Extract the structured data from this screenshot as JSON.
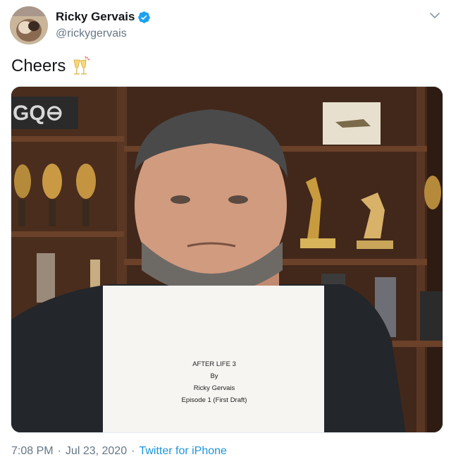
{
  "author": {
    "display_name": "Ricky Gervais",
    "handle": "@rickygervais",
    "verified": true
  },
  "tweet": {
    "text": "Cheers",
    "emoji": "clinking-glasses",
    "time": "7:08 PM",
    "date": "Jul 23, 2020",
    "source": "Twitter for iPhone"
  },
  "photo": {
    "paper_lines": [
      "AFTER LIFE 3",
      "By",
      "Ricky Gervais",
      "Episode 1 (First Draft)"
    ]
  },
  "colors": {
    "link": "#1b95e0",
    "verified": "#1da1f2",
    "secondary_text": "#657786"
  },
  "icons": [
    "verified-badge-icon",
    "chevron-down-icon",
    "clinking-glasses-emoji"
  ]
}
